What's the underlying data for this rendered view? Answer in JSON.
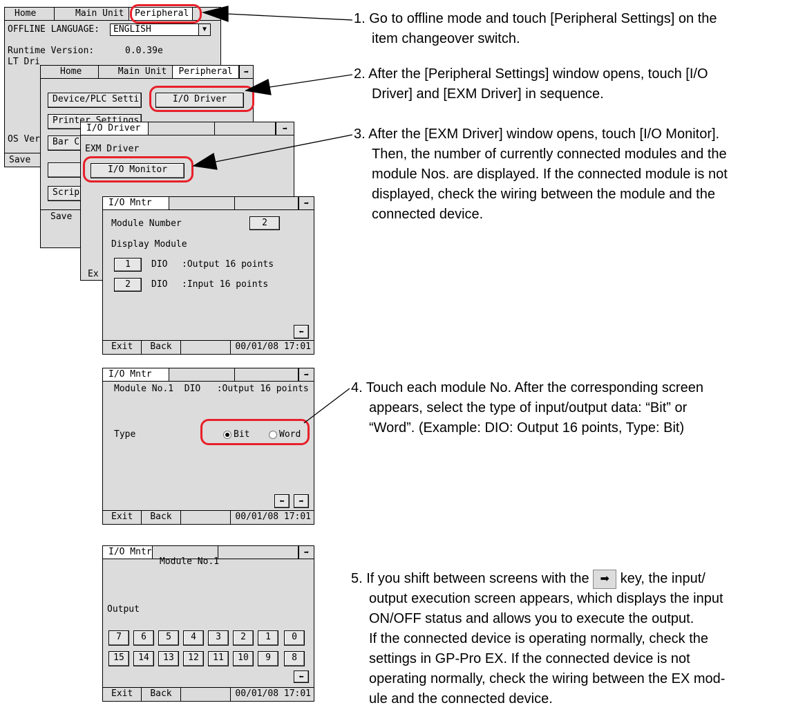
{
  "panel1": {
    "tabs": [
      "Home",
      "Main Unit",
      "Peripheral"
    ],
    "language_label": "OFFLINE LANGUAGE:",
    "language_value": "ENGLISH",
    "runtime_label": "Runtime Version:",
    "runtime_value": "0.0.39e",
    "lt_label": "LT Dri",
    "os_label": "OS Ver",
    "save": "Save"
  },
  "panel2": {
    "tabs": [
      "Home",
      "Main Unit",
      "Peripheral"
    ],
    "device_plc": "Device/PLC Setti",
    "io_driver": "I/O Driver",
    "printer": "Printer Settings",
    "bar": "Bar C",
    "script": "Scrip",
    "save": "Save"
  },
  "panel3": {
    "tab": "I/O Driver",
    "exm": "EXM Driver",
    "io_monitor": "I/O Monitor",
    "exit_partial": "Ex"
  },
  "panel4": {
    "tab": "I/O Mntr",
    "module_number_label": "Module Number",
    "module_number_value": "2",
    "display_module": "Display Module",
    "modules": [
      {
        "no": "1",
        "type": "DIO",
        "desc": ":Output 16 points"
      },
      {
        "no": "2",
        "type": "DIO",
        "desc": ":Input 16 points"
      }
    ],
    "exit": "Exit",
    "back": "Back",
    "clock": "00/01/08 17:01"
  },
  "panel5": {
    "tab": "I/O Mntr",
    "module_line": "Module No.1  DIO   :Output 16 points",
    "type_label": "Type",
    "bit": "Bit",
    "word": "Word",
    "exit": "Exit",
    "back": "Back",
    "clock": "00/01/08 17:01"
  },
  "panel6": {
    "tab": "I/O Mntr",
    "title": "Module No.1",
    "output_label": "Output",
    "row1": [
      "7",
      "6",
      "5",
      "4",
      "3",
      "2",
      "1",
      "0"
    ],
    "row2": [
      "15",
      "14",
      "13",
      "12",
      "11",
      "10",
      "9",
      "8"
    ],
    "exit": "Exit",
    "back": "Back",
    "clock": "00/01/08 17:01"
  },
  "instructions": {
    "step1": [
      "1. Go to offline mode and touch [Peripheral Settings] on the",
      "item changeover switch."
    ],
    "step2": [
      "2. After the [Peripheral Settings] window opens, touch [I/O",
      "Driver] and [EXM Driver] in sequence."
    ],
    "step3": [
      "3. After the [EXM Driver] window opens, touch [I/O Monitor].",
      "Then, the number of currently connected modules and the",
      "module Nos. are displayed. If the connected module is not",
      "displayed, check the wiring between the module and the",
      "connected device."
    ],
    "step4": [
      "4. Touch each module No. After the corresponding screen",
      "appears, select the type of input/output data: “Bit” or",
      "“Word”. (Example: DIO: Output 16 points, Type: Bit)"
    ],
    "step5_prefix": "5. If you shift between screens with the",
    "step5_suffix": "key, the input/",
    "step5_rest": [
      "output execution screen appears, which displays the input",
      "ON/OFF status and allows you to execute the output.",
      "If the connected device is operating normally, check the",
      "settings in GP-Pro EX.  If the connected device is not",
      "operating normally, check the wiring between the EX mod-",
      "ule and the connected device."
    ]
  },
  "colors": {
    "highlight": "#e8202a",
    "panel_bg": "#dcdcdc"
  }
}
